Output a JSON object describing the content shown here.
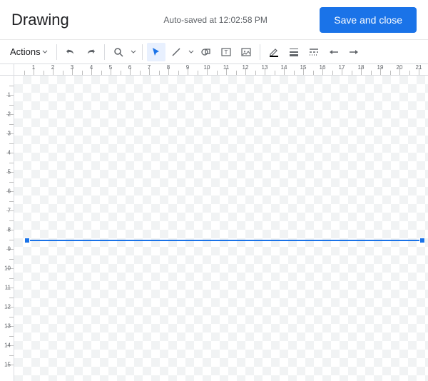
{
  "header": {
    "title": "Drawing",
    "autosave": "Auto-saved at 12:02:58 PM",
    "save_label": "Save and close"
  },
  "toolbar": {
    "actions_label": "Actions"
  },
  "ruler": {
    "h_major": [
      1,
      2,
      3,
      4,
      5,
      6,
      7,
      8,
      9,
      10,
      11,
      12,
      13,
      14,
      15,
      16,
      17,
      18,
      19,
      20,
      21
    ],
    "v_major": [
      1,
      2,
      3,
      4,
      5,
      6,
      7,
      8,
      9,
      10,
      11,
      12,
      13,
      14,
      15
    ]
  },
  "colors": {
    "primary": "#1a73e8"
  }
}
